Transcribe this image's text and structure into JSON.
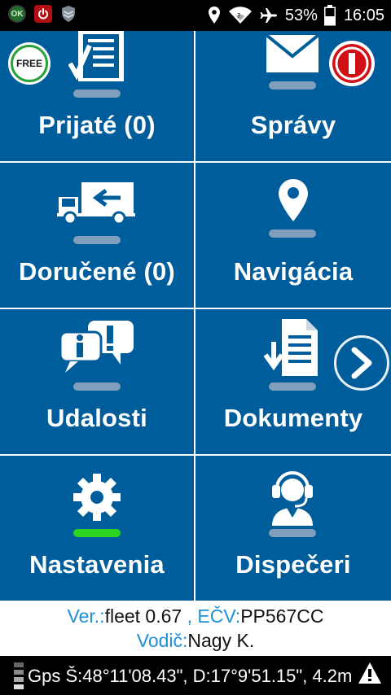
{
  "statusbar": {
    "battery_percent": "53%",
    "time": "16:05",
    "ok_badge": "OK",
    "icons": [
      "ok-icon",
      "power-icon",
      "shield-icon",
      "location-icon",
      "wifi-icon",
      "airplane-icon",
      "battery-icon"
    ]
  },
  "tiles": [
    {
      "label": "Prijaté (0)",
      "icon": "clipboard-check-icon"
    },
    {
      "label": "Správy",
      "icon": "envelope-icon"
    },
    {
      "label": "Doručené (0)",
      "icon": "delivery-truck-icon"
    },
    {
      "label": "Navigácia",
      "icon": "map-pin-icon"
    },
    {
      "label": "Udalosti",
      "icon": "info-chat-icon"
    },
    {
      "label": "Dokumenty",
      "icon": "document-download-icon"
    },
    {
      "label": "Nastavenia",
      "icon": "gear-icon"
    },
    {
      "label": "Dispečeri",
      "icon": "operator-headset-icon"
    }
  ],
  "free_badge": "FREE",
  "info": {
    "ver_key": "Ver.:",
    "ver_val": "fleet 0.67",
    "ecv_key": " , EČV:",
    "ecv_val": "PP567CC",
    "driver_key": "Vodič:",
    "driver_val": "Nagy K."
  },
  "gps": {
    "text": "Gps Š:48°11'08.43\", D:17°9'51.15\", 4.2m"
  },
  "colors": {
    "tile_bg": "#005d9b",
    "key_text": "#1e8fd8",
    "status_green": "#2bd41f",
    "alert_red": "#d10f14"
  }
}
